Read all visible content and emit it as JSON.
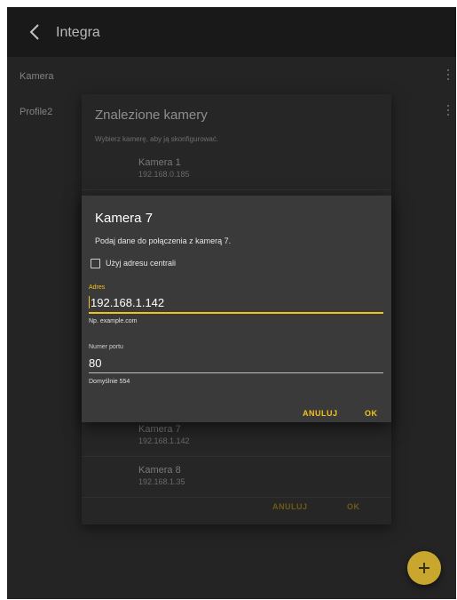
{
  "app": {
    "title": "Integra"
  },
  "list": [
    {
      "label": "Kamera"
    },
    {
      "label": "Profile2"
    }
  ],
  "found_dialog": {
    "title": "Znalezione kamery",
    "subtitle": "Wybierz kamerę, aby ją skonfigurować.",
    "cameras": [
      {
        "name": "Kamera 1",
        "ip": "192.168.0.185"
      },
      {
        "name": "Kamera 7",
        "ip": "192.168.1.142"
      },
      {
        "name": "Kamera 8",
        "ip": "192.168.1.35"
      }
    ],
    "cancel_label": "ANULUJ",
    "ok_label": "OK"
  },
  "camera_dialog": {
    "title": "Kamera 7",
    "message": "Podaj dane do połączenia z kamerą 7.",
    "use_panel_address": {
      "label": "Użyj adresu centrali",
      "checked": false
    },
    "address": {
      "label": "Adres",
      "value": "192.168.1.142",
      "help": "Np. example.com"
    },
    "port": {
      "label": "Numer portu",
      "value": "80",
      "help": "Domyślnie 554"
    },
    "cancel_label": "ANULUJ",
    "ok_label": "OK"
  },
  "colors": {
    "accent": "#f2c21b",
    "fab": "#c9a72f",
    "surface": "#3a3a3a",
    "background": "#2b2b2b"
  },
  "icons": {
    "back": "chevron-left-icon",
    "more": "kebab-icon",
    "fab": "plus-icon"
  }
}
